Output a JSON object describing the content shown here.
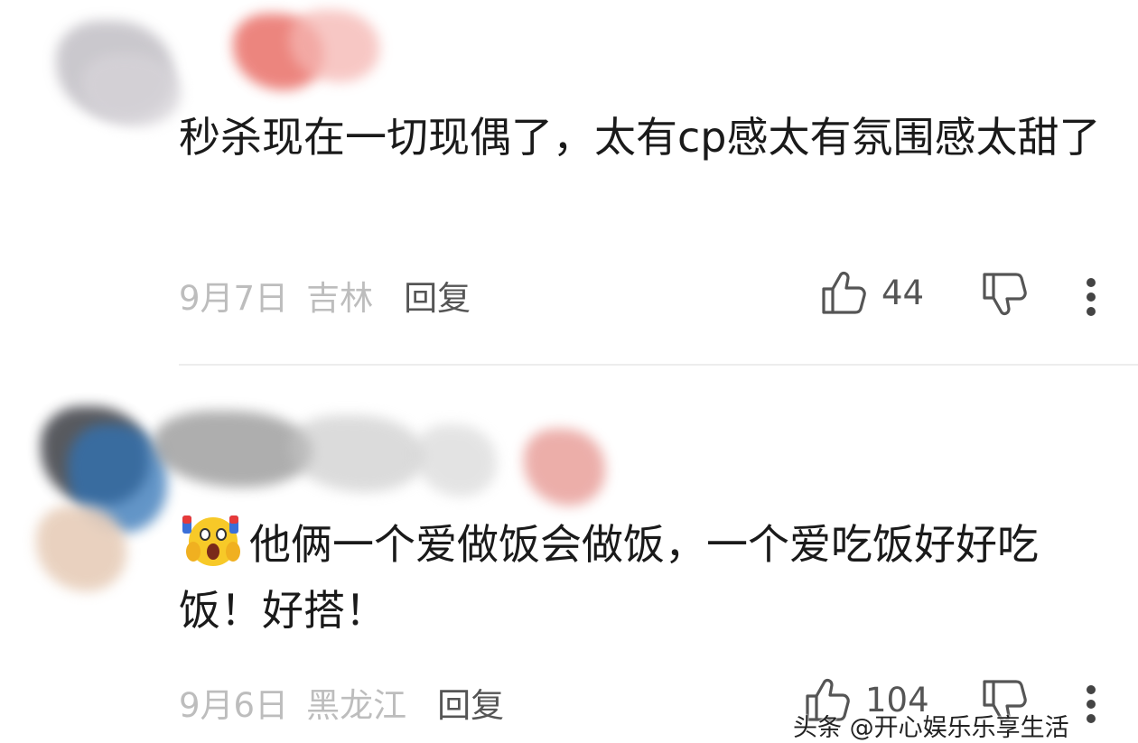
{
  "comments": [
    {
      "text": "秒杀现在一切现偶了，太有cp感太有氛围感太甜了",
      "date": "9月7日",
      "location": "吉林",
      "reply_label": "回复",
      "like_count": "44",
      "icons": {
        "like": "thumbs-up-icon",
        "dislike": "thumbs-down-icon",
        "more": "more-vertical-icon"
      }
    },
    {
      "emoji": "screaming-face-emoji",
      "text": "他俩一个爱做饭会做饭，一个爱吃饭好好吃饭！好搭！",
      "date": "9月6日",
      "location": "黑龙江",
      "reply_label": "回复",
      "like_count": "104",
      "icons": {
        "like": "thumbs-up-icon",
        "dislike": "thumbs-down-icon",
        "more": "more-vertical-icon"
      }
    }
  ],
  "watermark": "头条 @开心娱乐乐享生活",
  "colors": {
    "meta_gray": "#bdbdbd",
    "action_gray": "#555555",
    "text": "#1a1a1a",
    "divider": "#ededed"
  }
}
